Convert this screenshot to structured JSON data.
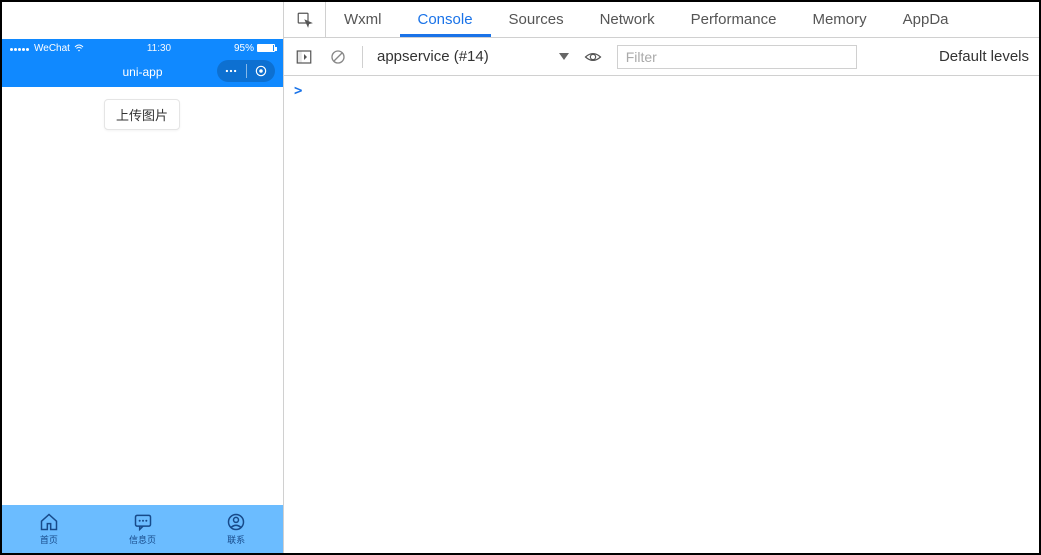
{
  "simulator": {
    "statusbar": {
      "carrier": "WeChat",
      "time": "11:30",
      "battery": "95%"
    },
    "nav_title": "uni-app",
    "upload_button": "上传图片",
    "tabs": [
      {
        "label": "首页"
      },
      {
        "label": "信息页"
      },
      {
        "label": "联系"
      }
    ]
  },
  "devtools": {
    "tabs": [
      "Wxml",
      "Console",
      "Sources",
      "Network",
      "Performance",
      "Memory",
      "AppDa"
    ],
    "active_tab_index": 1,
    "context_label": "appservice (#14)",
    "filter_placeholder": "Filter",
    "levels_label": "Default levels",
    "prompt": ">"
  }
}
